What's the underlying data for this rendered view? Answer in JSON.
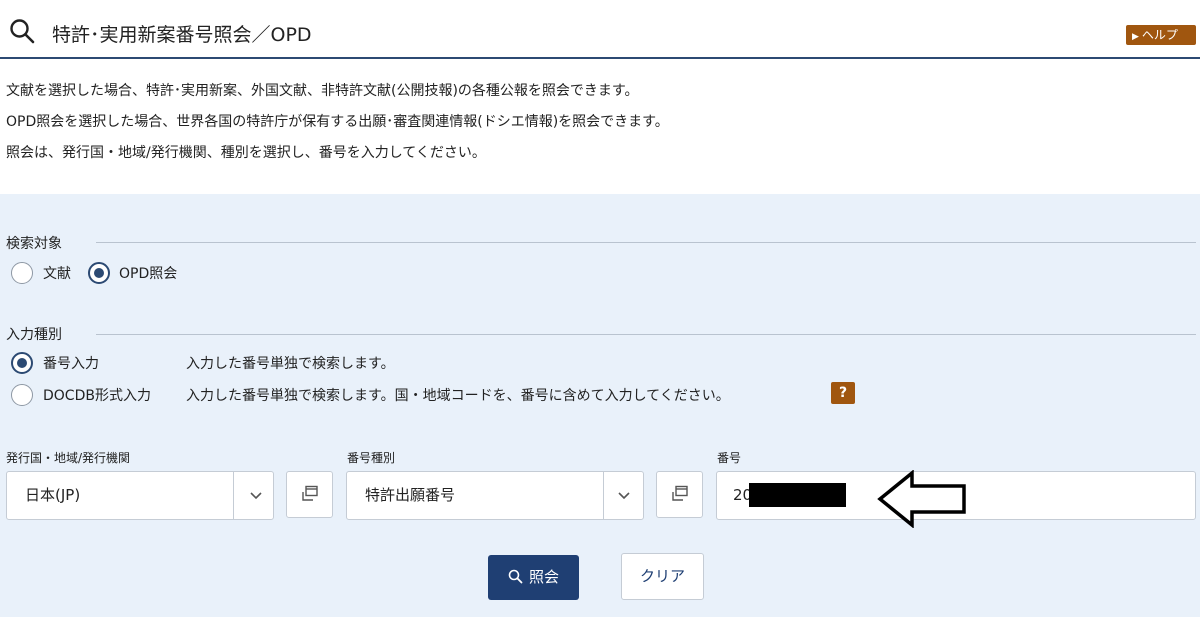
{
  "header": {
    "title": "特許･実用新案番号照会／OPD",
    "help_label": "ヘルプ"
  },
  "description": [
    "文献を選択した場合、特許･実用新案、外国文献、非特許文献(公開技報)の各種公報を照会できます。",
    "OPD照会を選択した場合、世界各国の特許庁が保有する出願･審査関連情報(ドシエ情報)を照会できます。",
    "照会は、発行国・地域/発行機関、種別を選択し、番号を入力してください。"
  ],
  "search_target": {
    "label": "検索対象",
    "options": [
      {
        "label": "文献",
        "checked": false
      },
      {
        "label": "OPD照会",
        "checked": true
      }
    ]
  },
  "input_type": {
    "label": "入力種別",
    "options": [
      {
        "label": "番号入力",
        "description": "入力した番号単独で検索します。",
        "checked": true
      },
      {
        "label": "DOCDB形式入力",
        "description": "入力した番号単独で検索します。国・地域コードを、番号に含めて入力してください。",
        "checked": false
      }
    ],
    "help_glyph": "?"
  },
  "fields": {
    "country": {
      "label": "発行国・地域/発行機関",
      "value": "日本(JP)"
    },
    "number_type": {
      "label": "番号種別",
      "value": "特許出願番号"
    },
    "number": {
      "label": "番号",
      "value": "20"
    }
  },
  "buttons": {
    "search_label": "照会",
    "clear_label": "クリア"
  },
  "colors": {
    "accent": "#2c4a73",
    "primary_button": "#1f3f73",
    "help_badge": "#a0560f",
    "panel_bg": "#e9f1fa"
  },
  "icons": {
    "header": "search-icon",
    "help": "play-triangle-icon",
    "select": "chevron-down-icon",
    "copy": "window-copy-icon",
    "annotation": "left-arrow-icon"
  }
}
